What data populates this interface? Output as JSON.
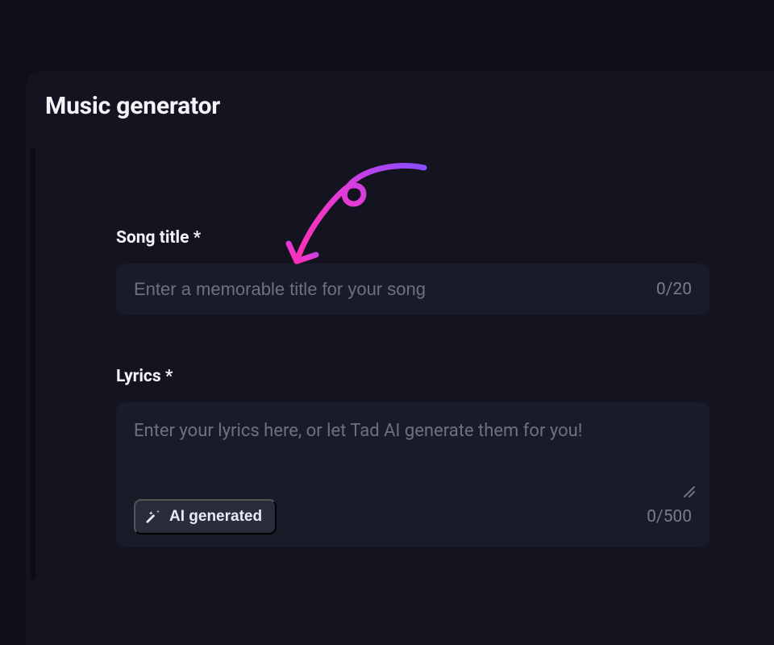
{
  "header": {
    "title": "Music generator"
  },
  "song_title": {
    "label": "Song title *",
    "placeholder": "Enter a memorable title for your song",
    "value": "",
    "counter": "0/20"
  },
  "lyrics": {
    "label": "Lyrics *",
    "placeholder": "Enter your lyrics here, or let Tad AI generate them for you!",
    "value": "",
    "counter": "0/500",
    "ai_button_label": "AI generated"
  }
}
